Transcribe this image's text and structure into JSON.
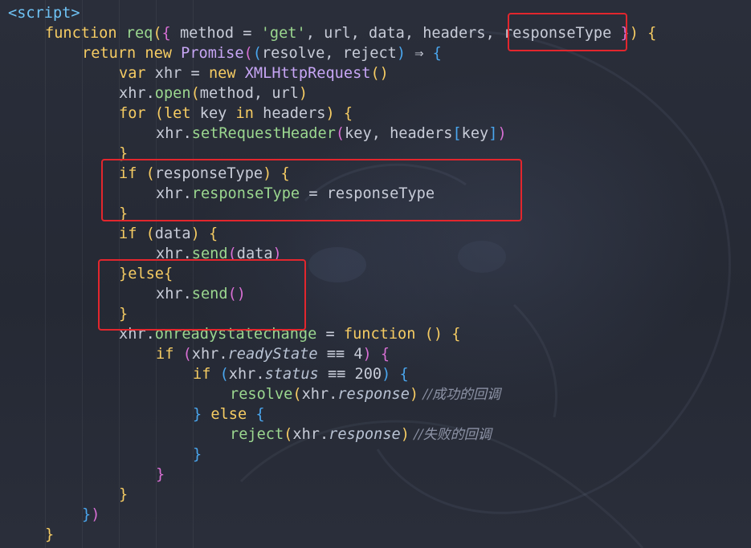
{
  "editor": {
    "lines": [
      {
        "indent": 0,
        "tokens": [
          {
            "t": "<script>",
            "c": "tag"
          }
        ]
      },
      {
        "indent": 1,
        "tokens": [
          {
            "t": "function ",
            "c": "kw"
          },
          {
            "t": "req",
            "c": "fn"
          },
          {
            "t": "(",
            "c": "b1"
          },
          {
            "t": "{",
            "c": "b2"
          },
          {
            "t": " method = ",
            "c": "id"
          },
          {
            "t": "'get'",
            "c": "str"
          },
          {
            "t": ", url, data, headers, responseType ",
            "c": "id"
          },
          {
            "t": "}",
            "c": "b2"
          },
          {
            "t": ")",
            "c": "b1"
          },
          {
            "t": " {",
            "c": "b1"
          }
        ]
      },
      {
        "indent": 2,
        "tokens": [
          {
            "t": "return ",
            "c": "kw"
          },
          {
            "t": "new ",
            "c": "kw"
          },
          {
            "t": "Promise",
            "c": "cls"
          },
          {
            "t": "(",
            "c": "b2"
          },
          {
            "t": "(",
            "c": "b3"
          },
          {
            "t": "resolve, reject",
            "c": "id"
          },
          {
            "t": ")",
            "c": "b3"
          },
          {
            "t": " ⇒ ",
            "c": "op"
          },
          {
            "t": "{",
            "c": "b3"
          }
        ]
      },
      {
        "indent": 3,
        "tokens": [
          {
            "t": "var ",
            "c": "kw"
          },
          {
            "t": "xhr = ",
            "c": "id"
          },
          {
            "t": "new ",
            "c": "kw"
          },
          {
            "t": "XMLHttpRequest",
            "c": "cls"
          },
          {
            "t": "()",
            "c": "b1"
          }
        ]
      },
      {
        "indent": 3,
        "tokens": [
          {
            "t": "xhr.",
            "c": "id"
          },
          {
            "t": "open",
            "c": "fn"
          },
          {
            "t": "(",
            "c": "b1"
          },
          {
            "t": "method, url",
            "c": "id"
          },
          {
            "t": ")",
            "c": "b1"
          }
        ]
      },
      {
        "indent": 3,
        "tokens": [
          {
            "t": "for ",
            "c": "kw"
          },
          {
            "t": "(",
            "c": "b1"
          },
          {
            "t": "let ",
            "c": "kw"
          },
          {
            "t": "key ",
            "c": "id"
          },
          {
            "t": "in ",
            "c": "kw"
          },
          {
            "t": "headers",
            "c": "id"
          },
          {
            "t": ")",
            "c": "b1"
          },
          {
            "t": " {",
            "c": "b1"
          }
        ]
      },
      {
        "indent": 4,
        "tokens": [
          {
            "t": "xhr.",
            "c": "id"
          },
          {
            "t": "setRequestHeader",
            "c": "fn"
          },
          {
            "t": "(",
            "c": "b2"
          },
          {
            "t": "key, headers",
            "c": "id"
          },
          {
            "t": "[",
            "c": "b3"
          },
          {
            "t": "key",
            "c": "id"
          },
          {
            "t": "]",
            "c": "b3"
          },
          {
            "t": ")",
            "c": "b2"
          }
        ]
      },
      {
        "indent": 3,
        "tokens": [
          {
            "t": "}",
            "c": "b1"
          }
        ]
      },
      {
        "indent": 3,
        "tokens": [
          {
            "t": "if ",
            "c": "kw"
          },
          {
            "t": "(",
            "c": "b1"
          },
          {
            "t": "responseType",
            "c": "id"
          },
          {
            "t": ")",
            "c": "b1"
          },
          {
            "t": " {",
            "c": "b1"
          }
        ]
      },
      {
        "indent": 4,
        "tokens": [
          {
            "t": "xhr.",
            "c": "id"
          },
          {
            "t": "responseType",
            "c": "prop"
          },
          {
            "t": " = responseType",
            "c": "id"
          }
        ]
      },
      {
        "indent": 3,
        "tokens": [
          {
            "t": "}",
            "c": "b1"
          }
        ]
      },
      {
        "indent": 3,
        "tokens": [
          {
            "t": "if ",
            "c": "kw"
          },
          {
            "t": "(",
            "c": "b1"
          },
          {
            "t": "data",
            "c": "id"
          },
          {
            "t": ")",
            "c": "b1"
          },
          {
            "t": " {",
            "c": "b1"
          }
        ]
      },
      {
        "indent": 4,
        "tokens": [
          {
            "t": "xhr.",
            "c": "id"
          },
          {
            "t": "send",
            "c": "fn"
          },
          {
            "t": "(",
            "c": "b2"
          },
          {
            "t": "data",
            "c": "id"
          },
          {
            "t": ")",
            "c": "b2"
          }
        ]
      },
      {
        "indent": 3,
        "tokens": [
          {
            "t": "}",
            "c": "b1"
          },
          {
            "t": "else",
            "c": "kw"
          },
          {
            "t": "{",
            "c": "b1"
          }
        ]
      },
      {
        "indent": 4,
        "tokens": [
          {
            "t": "xhr.",
            "c": "id"
          },
          {
            "t": "send",
            "c": "fn"
          },
          {
            "t": "()",
            "c": "b2"
          }
        ]
      },
      {
        "indent": 3,
        "tokens": [
          {
            "t": "}",
            "c": "b1"
          }
        ]
      },
      {
        "indent": 3,
        "tokens": [
          {
            "t": "xhr.",
            "c": "id"
          },
          {
            "t": "onreadystatechange",
            "c": "prop"
          },
          {
            "t": " = ",
            "c": "id"
          },
          {
            "t": "function ",
            "c": "kw"
          },
          {
            "t": "()",
            "c": "b1"
          },
          {
            "t": " {",
            "c": "b1"
          }
        ]
      },
      {
        "indent": 4,
        "tokens": [
          {
            "t": "if ",
            "c": "kw"
          },
          {
            "t": "(",
            "c": "b2"
          },
          {
            "t": "xhr.",
            "c": "id"
          },
          {
            "t": "readyState",
            "c": "it"
          },
          {
            "t": " ≡≡ ",
            "c": "op"
          },
          {
            "t": "4",
            "c": "num"
          },
          {
            "t": ")",
            "c": "b2"
          },
          {
            "t": " {",
            "c": "b2"
          }
        ]
      },
      {
        "indent": 5,
        "tokens": [
          {
            "t": "if ",
            "c": "kw"
          },
          {
            "t": "(",
            "c": "b3"
          },
          {
            "t": "xhr.",
            "c": "id"
          },
          {
            "t": "status",
            "c": "it"
          },
          {
            "t": " ≡≡ ",
            "c": "op"
          },
          {
            "t": "200",
            "c": "num"
          },
          {
            "t": ")",
            "c": "b3"
          },
          {
            "t": " {",
            "c": "b3"
          }
        ]
      },
      {
        "indent": 6,
        "tokens": [
          {
            "t": "resolve",
            "c": "fn"
          },
          {
            "t": "(",
            "c": "b1"
          },
          {
            "t": "xhr.",
            "c": "id"
          },
          {
            "t": "response",
            "c": "it"
          },
          {
            "t": ")",
            "c": "b1"
          },
          {
            "t": " //成功的回调",
            "c": "cm"
          }
        ]
      },
      {
        "indent": 5,
        "tokens": [
          {
            "t": "}",
            "c": "b3"
          },
          {
            "t": " else ",
            "c": "kw"
          },
          {
            "t": "{",
            "c": "b3"
          }
        ]
      },
      {
        "indent": 6,
        "tokens": [
          {
            "t": "reject",
            "c": "fn"
          },
          {
            "t": "(",
            "c": "b1"
          },
          {
            "t": "xhr.",
            "c": "id"
          },
          {
            "t": "response",
            "c": "it"
          },
          {
            "t": ")",
            "c": "b1"
          },
          {
            "t": " //失败的回调",
            "c": "cm"
          }
        ]
      },
      {
        "indent": 5,
        "tokens": [
          {
            "t": "}",
            "c": "b3"
          }
        ]
      },
      {
        "indent": 4,
        "tokens": [
          {
            "t": "}",
            "c": "b2"
          }
        ]
      },
      {
        "indent": 3,
        "tokens": [
          {
            "t": "}",
            "c": "b1"
          }
        ]
      },
      {
        "indent": 2,
        "tokens": [
          {
            "t": "}",
            "c": "b3"
          },
          {
            "t": ")",
            "c": "b2"
          }
        ]
      },
      {
        "indent": 1,
        "tokens": [
          {
            "t": "}",
            "c": "b1"
          }
        ]
      }
    ]
  },
  "colors": {
    "highlight_box": "#e3262d",
    "keyword": "#f6cc63",
    "function": "#9bd78f",
    "class": "#c7a6f5",
    "tag": "#6fc3f5"
  }
}
